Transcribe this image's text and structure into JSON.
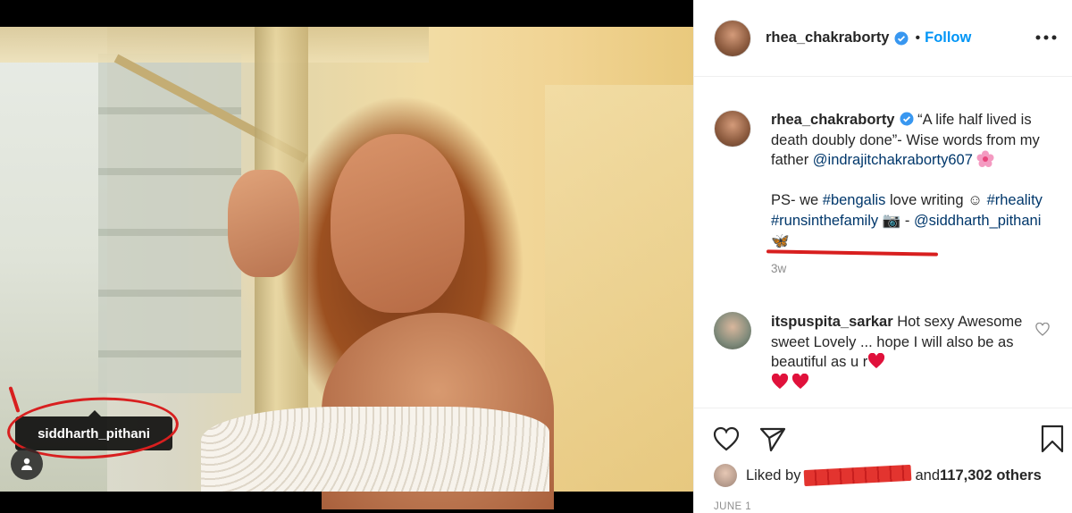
{
  "post": {
    "tagged_user": "siddharth_pithani"
  },
  "header": {
    "username": "rhea_chakraborty",
    "separator": "•",
    "follow_label": "Follow"
  },
  "caption": {
    "username": "rhea_chakraborty",
    "text_1": "“A life half lived is death doubly done”- Wise words from my father ",
    "mention_1": "@indrajitchakraborty607",
    "text_2": "PS- we ",
    "hashtag_1": "#bengalis",
    "text_3": " love writing ☺ ",
    "hashtag_2": "#rheality",
    "space": " ",
    "hashtag_3": "#runsinthefamily",
    "text_4": " 📷 - ",
    "mention_2": "@siddharth_pithani",
    "butterfly": "🦋",
    "time": "3w"
  },
  "comment": {
    "username": "itspuspita_sarkar",
    "text": " Hot sexy Awesome sweet Lovely ... hope I will also be as beautiful as u r"
  },
  "likes": {
    "prefix": "Liked by ",
    "suffix": " and ",
    "count": "117,302 others"
  },
  "date": "JUNE 1",
  "colors": {
    "accent": "#0095f6",
    "annotation_red": "#d81f1f",
    "link": "#00376b",
    "muted": "#8e8e8e"
  }
}
